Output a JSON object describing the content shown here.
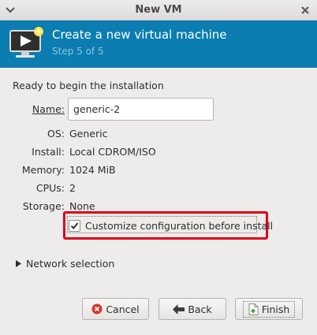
{
  "window": {
    "title": "New VM"
  },
  "header": {
    "title": "Create a new virtual machine",
    "step": "Step 5 of 5",
    "icon": "computer-new-icon",
    "bg_color": "#0b7db0"
  },
  "summary": {
    "heading": "Ready to begin the installation",
    "name_label": "Name:",
    "name_value": "generic-2",
    "os_label": "OS:",
    "os_value": "Generic",
    "install_label": "Install:",
    "install_value": "Local CDROM/ISO",
    "memory_label": "Memory:",
    "memory_value": "1024 MiB",
    "cpus_label": "CPUs:",
    "cpus_value": "2",
    "storage_label": "Storage:",
    "storage_value": "None"
  },
  "customize": {
    "label": "Customize configuration before install",
    "checked": true,
    "highlight_color": "#e0001a"
  },
  "network": {
    "label": "Network selection",
    "expanded": false
  },
  "buttons": {
    "cancel": "Cancel",
    "back": "Back",
    "finish": "Finish"
  }
}
